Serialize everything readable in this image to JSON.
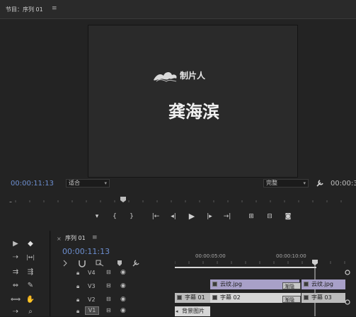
{
  "program_panel": {
    "title": "节目：序列 01",
    "menu_icon": "≡",
    "timecode": "00:00:11:13",
    "fit": "适合",
    "quality": "完整",
    "duration_partial": "00:00:3",
    "title_small": "制片人",
    "title_big": "龚海滨"
  },
  "transport": {
    "buttons": [
      "mark-in",
      "brace-left",
      "brace-right",
      "go-to-in",
      "step-back",
      "play",
      "step-forward",
      "go-to-out",
      "lift",
      "extract",
      "export-frame"
    ],
    "glyphs": [
      "▾",
      "{",
      "}",
      "|←",
      "◂|",
      "▶",
      "|▸",
      "→|",
      "⊞",
      "⊟",
      "◙"
    ]
  },
  "tools": {
    "glyphs": [
      "▶",
      "◆",
      "⇢",
      "|↔|",
      "⇉",
      "⇶",
      "⇔",
      "✎",
      "⟺",
      "✋",
      "⇢",
      "⌕"
    ],
    "names": [
      "selection-tool-icon",
      "track-select-icon",
      "ripple-edit-icon",
      "rate-stretch-icon",
      "rolling-edit-icon",
      "slip-icon",
      "slide-icon",
      "pen-icon",
      "razor-icon",
      "hand-icon",
      "type-icon",
      "zoom-icon"
    ]
  },
  "timeline": {
    "tab": "序列 01",
    "menu_icon": "≡",
    "close": "×",
    "timecode": "00:00:11:13",
    "ruler_labels": [
      "00:00:05:00",
      "00:00:10:00"
    ],
    "tracks": [
      "V4",
      "V3",
      "V2",
      "V1"
    ],
    "clips": [
      {
        "track": "V3",
        "label": "云纹.jpg"
      },
      {
        "track": "V3",
        "label": "云纹.jpg"
      },
      {
        "track": "V3",
        "label": "渐隐"
      },
      {
        "track": "V2",
        "label": "字幕 01"
      },
      {
        "track": "V2",
        "label": "字幕 02"
      },
      {
        "track": "V2",
        "label": "渐隐"
      },
      {
        "track": "V2",
        "label": "字幕 03"
      },
      {
        "track": "V1",
        "label": "背景图片"
      }
    ]
  },
  "colors": {
    "timecode_blue": "#6d8fd0",
    "clip_purple": "#a8a0c8",
    "clip_light": "#d6d6d6",
    "viewer_bg": "#2a2a2a"
  }
}
